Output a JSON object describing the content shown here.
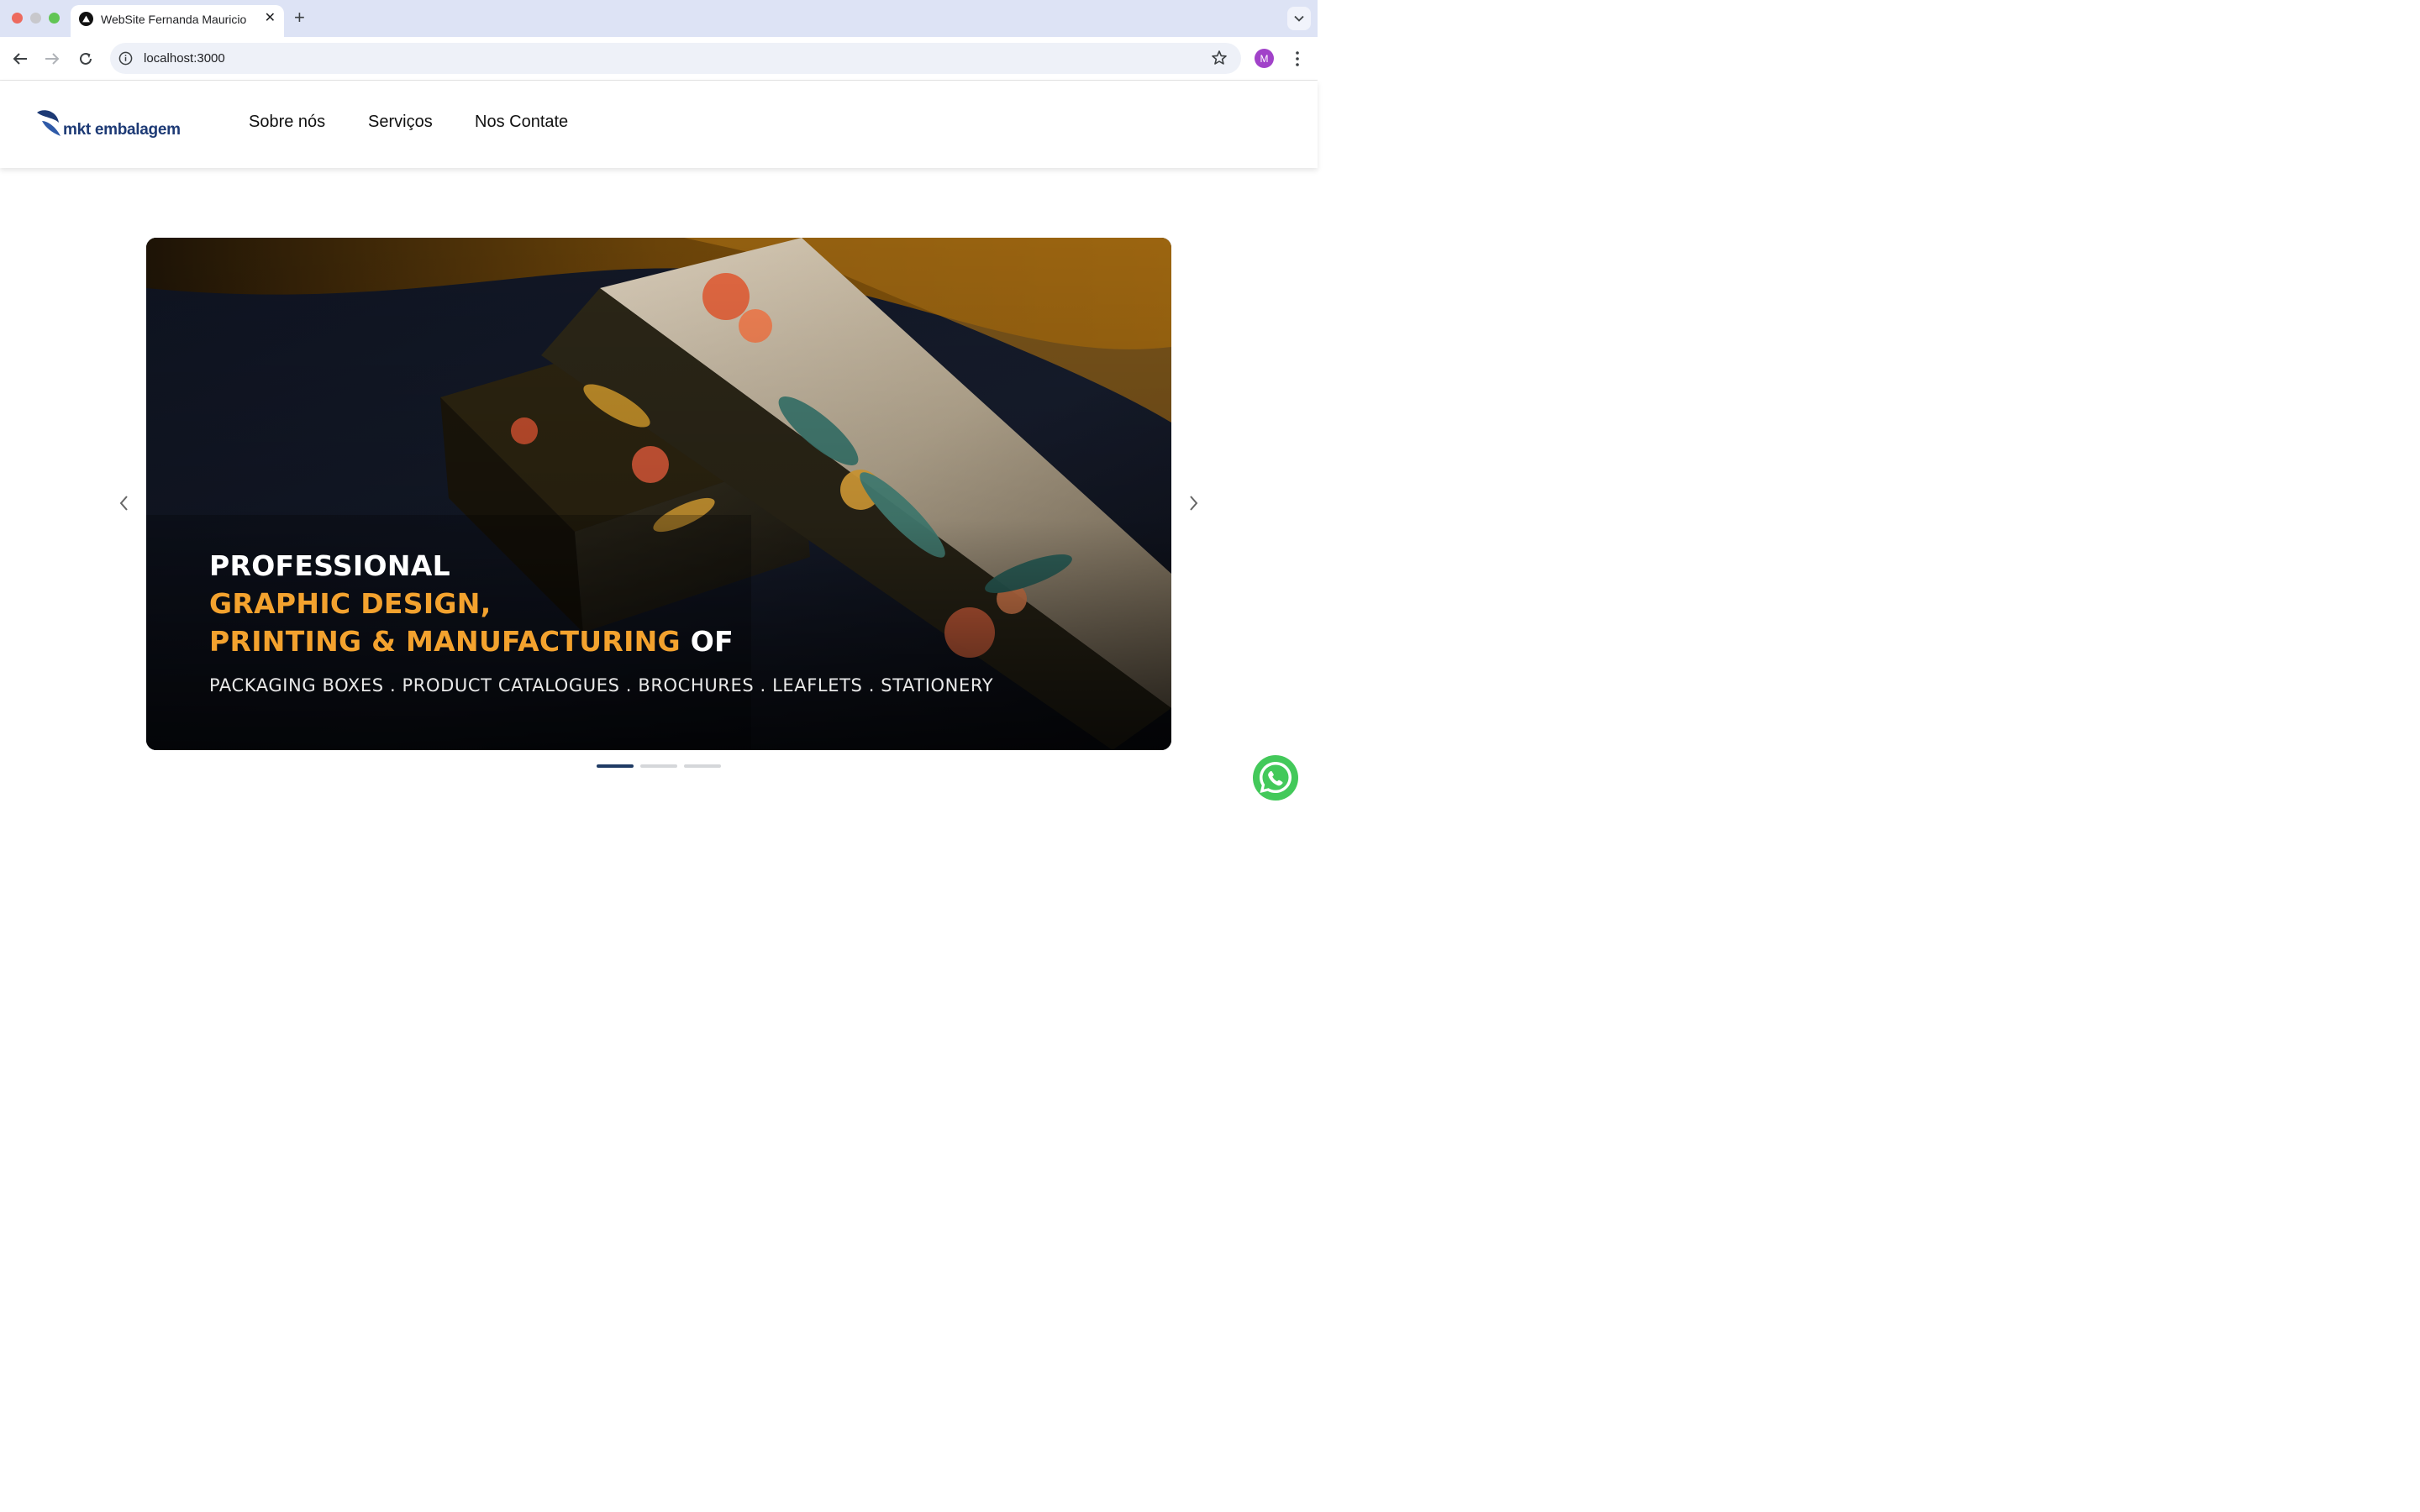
{
  "browser": {
    "tab_title": "WebSite Fernanda Mauricio",
    "close_glyph": "✕",
    "new_tab_glyph": "+",
    "url": "localhost:3000",
    "profile_initial": "M",
    "icons": [
      "site-favicon",
      "back-arrow-icon",
      "forward-arrow-icon",
      "reload-icon",
      "site-info-icon",
      "bookmark-star-icon",
      "kebab-menu-icon",
      "tab-search-chevron-icon"
    ]
  },
  "header": {
    "logo_text": "mkt embalagem",
    "nav": [
      "Sobre nós",
      "Serviços",
      "Nos Contate"
    ]
  },
  "carousel": {
    "slide": {
      "line1": "PROFESSIONAL",
      "line2": "GRAPHIC DESIGN,",
      "line3_orange": "PRINTING & MANUFACTURING",
      "line3_white": " OF",
      "subline": "PACKAGING BOXES . PRODUCT CATALOGUES . BROCHURES . LEAFLETS . STATIONERY"
    },
    "slide_count": 3,
    "active_index": 0
  },
  "colors": {
    "brand_blue": "#1d3a75",
    "accent_orange": "#f3a22e",
    "whatsapp_green": "#43c95a",
    "active_dot": "#1f3b64"
  }
}
